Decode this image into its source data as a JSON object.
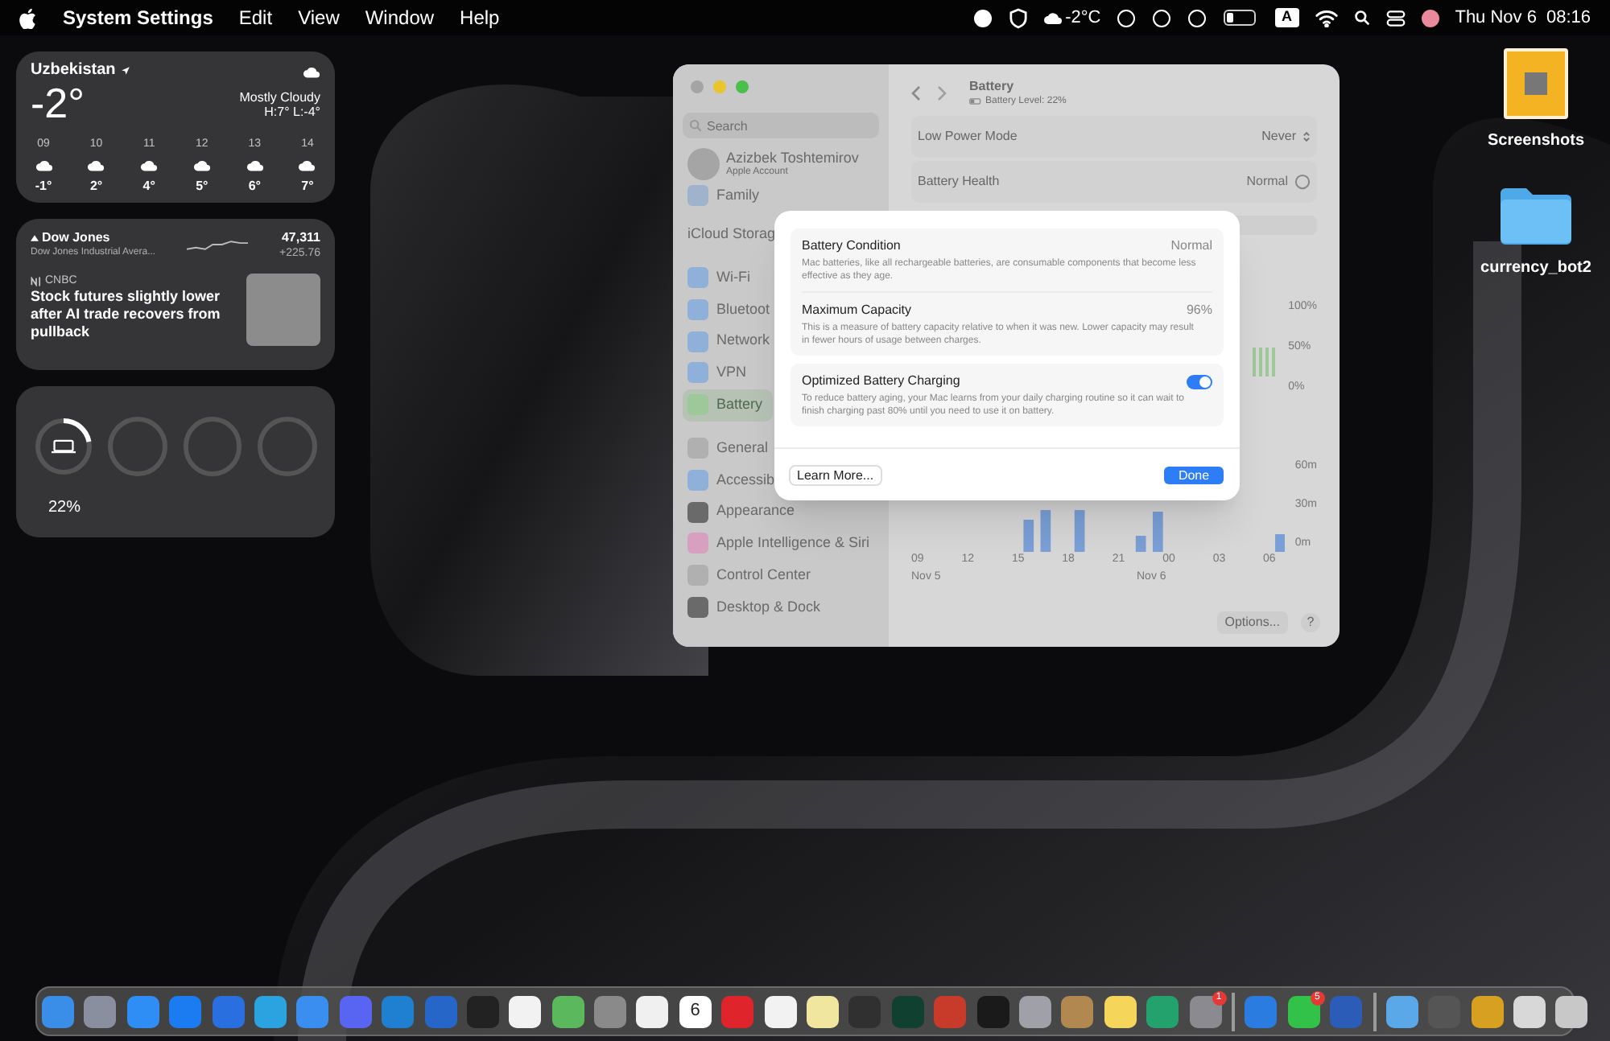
{
  "menu_bar": {
    "app": "System Settings",
    "menus": [
      "Edit",
      "View",
      "Window",
      "Help"
    ],
    "weather": "-2°C",
    "input_source": "A",
    "date": "Thu Nov 6",
    "time": "08:16"
  },
  "weather_widget": {
    "location": "Uzbekistan",
    "temperature": "-2°",
    "condition": "Mostly Cloudy",
    "high_low": "H:7° L:-4°",
    "hours": [
      {
        "hour": "09",
        "temp": "-1°"
      },
      {
        "hour": "10",
        "temp": "2°"
      },
      {
        "hour": "11",
        "temp": "4°"
      },
      {
        "hour": "12",
        "temp": "5°"
      },
      {
        "hour": "13",
        "temp": "6°"
      },
      {
        "hour": "14",
        "temp": "7°"
      }
    ]
  },
  "stocks_widget": {
    "symbol": "Dow Jones",
    "name": "Dow Jones Industrial Avera...",
    "price": "47,311",
    "change": "+225.76",
    "news_source": "CNBC",
    "headline": "Stock futures slightly lower after AI trade recovers from pullback"
  },
  "batteries_widget": {
    "level": 0.22,
    "reading": "22%"
  },
  "desktop_items": [
    {
      "kind": "screenshots",
      "label": "Screenshots"
    },
    {
      "kind": "folder",
      "label": "currency_bot2"
    }
  ],
  "settings_window": {
    "search": {
      "placeholder": "Search"
    },
    "account": {
      "name": "Azizbek Toshtemirov",
      "subtitle": "Apple Account"
    },
    "sidebar": [
      {
        "label": "Family",
        "color": "#9fb3cc",
        "selected": false
      },
      {
        "label": "iCloud Storag",
        "selected": false
      },
      {
        "label": "Wi-Fi",
        "color": "#8fb0d8",
        "selected": false
      },
      {
        "label": "Bluetoot",
        "color": "#8fb0d8",
        "selected": false
      },
      {
        "label": "Network",
        "color": "#8fb0d8",
        "selected": false
      },
      {
        "label": "VPN",
        "color": "#8fb0d8",
        "selected": false
      },
      {
        "label": "Battery",
        "color": "#9cc89a",
        "selected": true
      },
      {
        "label": "General",
        "color": "#b0b0b0",
        "selected": false
      },
      {
        "label": "Accessib",
        "color": "#8fb0d8",
        "selected": false
      },
      {
        "label": "Appearance",
        "color": "#6a6a6a",
        "selected": false
      },
      {
        "label": "Apple Intelligence & Siri",
        "color": "#d8a0c0",
        "selected": false
      },
      {
        "label": "Control Center",
        "color": "#b0b0b0",
        "selected": false
      },
      {
        "label": "Desktop & Dock",
        "color": "#6a6a6a",
        "selected": false
      }
    ],
    "title": "Battery",
    "subtitle": "Battery Level: 22%",
    "rows": [
      {
        "label": "Low Power Mode",
        "value": "Never",
        "kind": "popup"
      },
      {
        "label": "Battery Health",
        "value": "Normal",
        "kind": "info"
      }
    ],
    "level_chart": {
      "y_labels": [
        "100%",
        "50%",
        "0%"
      ]
    },
    "usage_chart": {
      "y_labels": [
        "60m",
        "30m",
        "0m"
      ],
      "x_labels": [
        "09",
        "12",
        "15",
        "18",
        "21",
        "00",
        "03",
        "06"
      ],
      "dates": [
        {
          "label": "Nov 5"
        },
        {
          "label": "Nov 6"
        }
      ]
    },
    "options_button": "Options...",
    "help_button": "?"
  },
  "dialog": {
    "items": [
      {
        "title": "Battery Condition",
        "value": "Normal",
        "description": "Mac batteries, like all rechargeable batteries, are consumable components that become less effective as they age.",
        "kind": "value"
      },
      {
        "title": "Maximum Capacity",
        "value": "96%",
        "description": "This is a measure of battery capacity relative to when it was new. Lower capacity may result in fewer hours of usage between charges.",
        "kind": "value"
      },
      {
        "title": "Optimized Battery Charging",
        "on": true,
        "description": "To reduce battery aging, your Mac learns from your daily charging routine so it can wait to finish charging past 80% until you need to use it on battery.",
        "kind": "toggle"
      }
    ],
    "buttons": [
      {
        "label": "Learn More...",
        "kind": "secondary"
      },
      {
        "label": "Done",
        "kind": "primary"
      }
    ]
  },
  "dock": {
    "apps": [
      {
        "color": "#3b8ee8"
      },
      {
        "color": "#8a8fa0"
      },
      {
        "color": "#2f8ef5"
      },
      {
        "color": "#1a7cf0"
      },
      {
        "color": "#2a6fe0"
      },
      {
        "color": "#2aa3e0"
      },
      {
        "color": "#3a8ef0"
      },
      {
        "color": "#5865f2"
      },
      {
        "color": "#1f7fd0"
      },
      {
        "color": "#2566c8"
      },
      {
        "color": "#222222"
      },
      {
        "color": "#f2f2f2"
      },
      {
        "color": "#5cb85c"
      },
      {
        "color": "#8a8a8a"
      },
      {
        "color": "#f0f0f0"
      },
      {
        "color": "#ffffff",
        "text": "6"
      },
      {
        "color": "#e0242c"
      },
      {
        "color": "#f2f2f2"
      },
      {
        "color": "#f0e6a0"
      },
      {
        "color": "#303030"
      },
      {
        "color": "#104030"
      },
      {
        "color": "#c83a2a"
      },
      {
        "color": "#1a1a1a"
      },
      {
        "color": "#a0a0a8"
      },
      {
        "color": "#b08850"
      },
      {
        "color": "#f5d65a"
      },
      {
        "color": "#23a26d"
      },
      {
        "color": "#8a8a90",
        "badge": "1"
      },
      {
        "color": "#2a7ce0",
        "separator_before": true
      },
      {
        "color": "#32c24a",
        "badge": "5"
      },
      {
        "color": "#2b5cb8"
      },
      {
        "color": "#5aa8e8",
        "separator_before": true
      },
      {
        "color": "#555555"
      },
      {
        "color": "#d8a020"
      },
      {
        "color": "#d8d8d8"
      },
      {
        "color": "#c8c8c8"
      }
    ]
  }
}
